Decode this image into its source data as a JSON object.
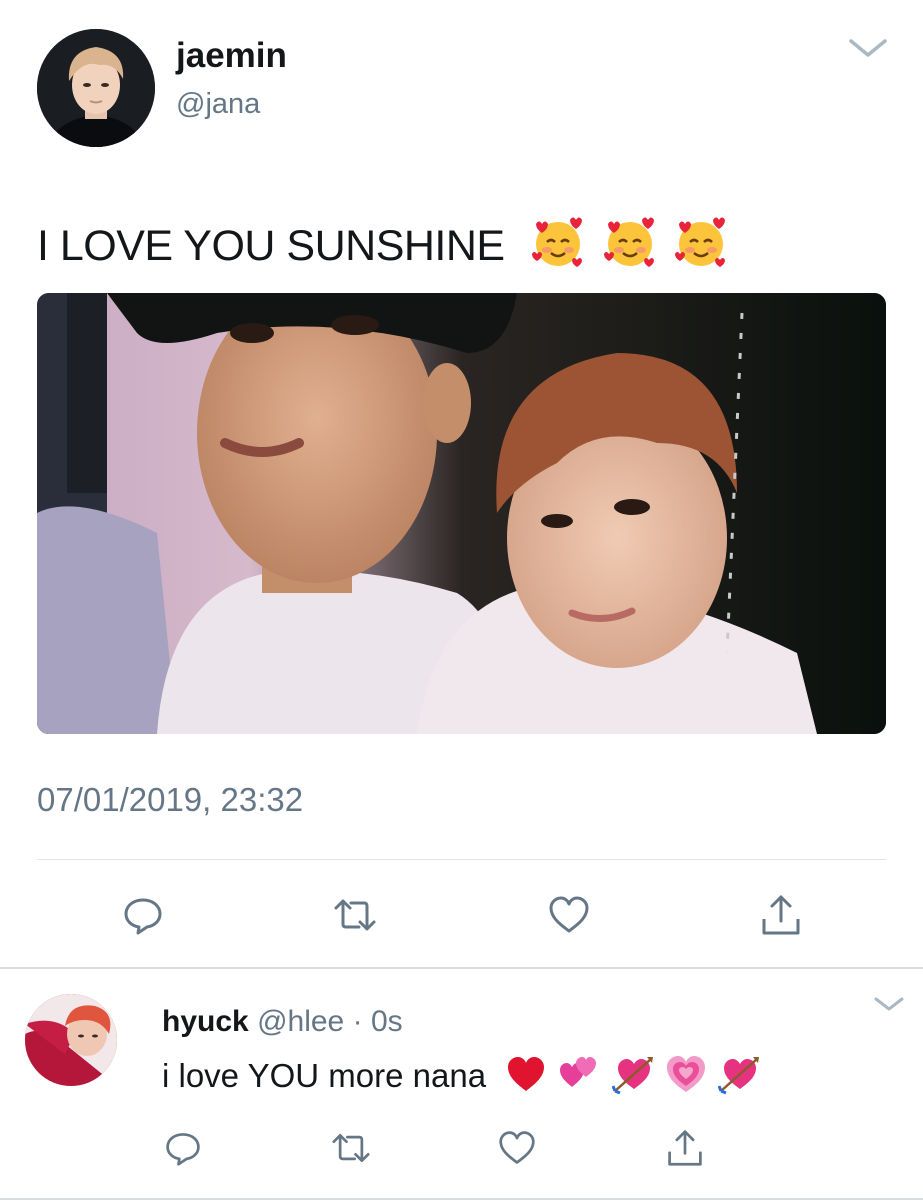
{
  "main_tweet": {
    "display_name": "jaemin",
    "handle": "@jana",
    "text": "I LOVE YOU SUNSHINE",
    "emojis": [
      "smiling-face-with-hearts",
      "smiling-face-with-hearts",
      "smiling-face-with-hearts"
    ],
    "timestamp": "07/01/2019, 23:32",
    "actions": [
      "reply-icon",
      "retweet-icon",
      "like-icon",
      "share-icon"
    ]
  },
  "reply_tweet": {
    "display_name": "hyuck",
    "handle": "@hlee",
    "separator": "·",
    "time": "0s",
    "text": "i love YOU more nana",
    "emojis": [
      "red-heart",
      "two-hearts",
      "heart-with-arrow",
      "growing-heart",
      "heart-with-arrow"
    ],
    "actions": [
      "reply-icon",
      "retweet-icon",
      "like-icon",
      "share-icon"
    ]
  },
  "colors": {
    "text_primary": "#14171a",
    "text_secondary": "#657786",
    "divider": "#dfe3e6",
    "icon": "#657786"
  }
}
